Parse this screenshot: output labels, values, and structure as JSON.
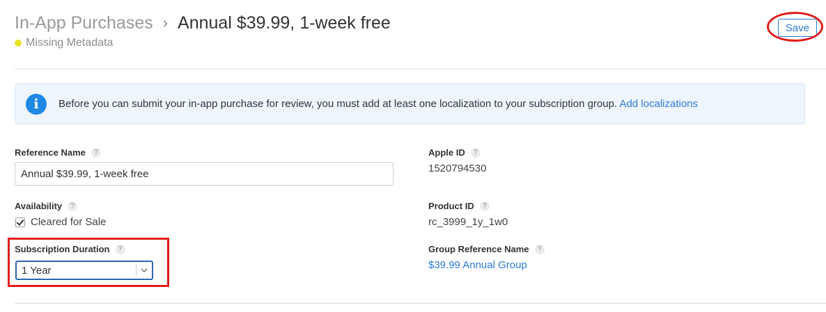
{
  "header": {
    "breadcrumb_root": "In-App Purchases",
    "breadcrumb_separator": "›",
    "title": "Annual $39.99, 1-week free",
    "status": "Missing Metadata",
    "status_color": "#e6e227"
  },
  "toolbar": {
    "save_label": "Save"
  },
  "banner": {
    "icon": "info-icon",
    "icon_glyph": "i",
    "message": "Before you can submit your in-app purchase for review, you must add at least one localization to your subscription group. ",
    "link_label": "Add localizations"
  },
  "form": {
    "help_glyph": "?",
    "reference_name": {
      "label": "Reference Name",
      "value": "Annual $39.99, 1-week free"
    },
    "availability": {
      "label": "Availability",
      "checkbox_label": "Cleared for Sale",
      "checked": true
    },
    "subscription_duration": {
      "label": "Subscription Duration",
      "selected": "1 Year"
    },
    "apple_id": {
      "label": "Apple ID",
      "value": "1520794530"
    },
    "product_id": {
      "label": "Product ID",
      "value": "rc_3999_1y_1w0"
    },
    "group_reference_name": {
      "label": "Group Reference Name",
      "value": "$39.99 Annual Group"
    }
  },
  "colors": {
    "accent": "#2d7ad6",
    "annotation": "#e21b1b",
    "banner_bg": "#eef5fc"
  }
}
